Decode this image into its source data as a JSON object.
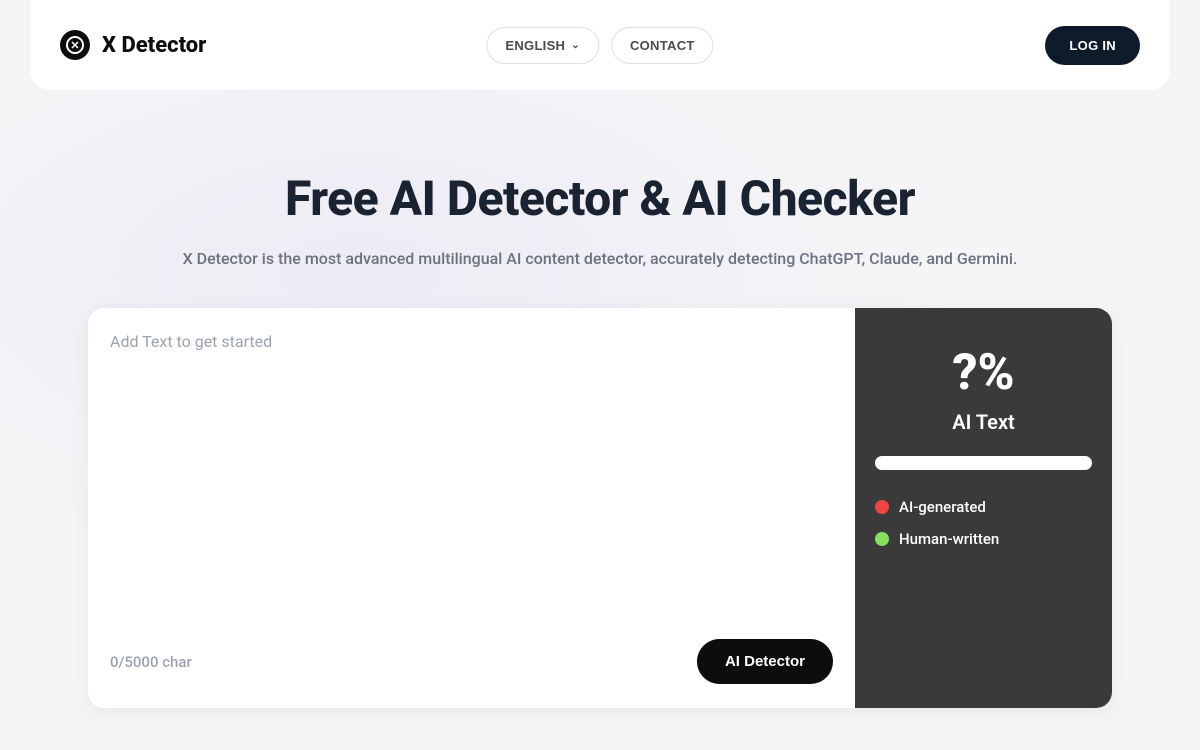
{
  "header": {
    "logo_text": "X Detector",
    "language_label": "ENGLISH",
    "contact_label": "CONTACT",
    "login_label": "LOG IN"
  },
  "hero": {
    "title": "Free AI Detector & AI Checker",
    "subtitle": "X Detector is the most advanced multilingual AI content detector, accurately detecting ChatGPT, Claude, and Germini."
  },
  "detector": {
    "placeholder": "Add Text to get started",
    "char_count": "0/5000 char",
    "button_label": "AI Detector"
  },
  "result": {
    "percentage": "?%",
    "label": "AI Text",
    "legend_ai": "AI-generated",
    "legend_human": "Human-written"
  }
}
